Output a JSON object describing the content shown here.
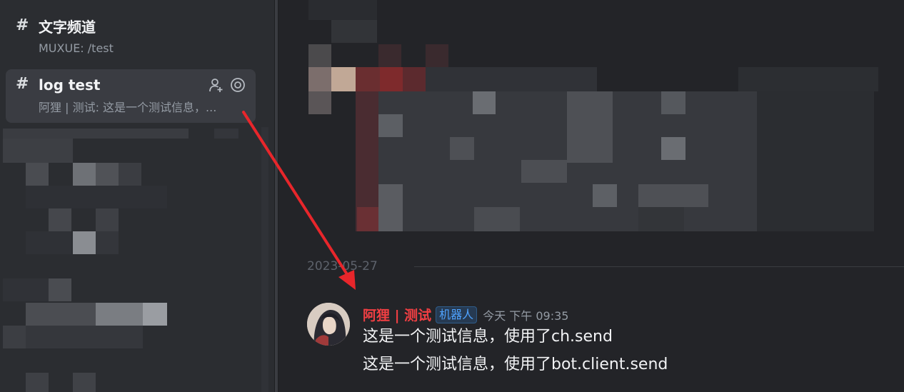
{
  "sidebar": {
    "channels": [
      {
        "title": "文字频道",
        "subtitle": "MUXUE: /test"
      },
      {
        "title": "log test",
        "subtitle": "阿狸 | 测试: 这是一个测试信息，..."
      }
    ]
  },
  "chat": {
    "date_separator": "2023-05-27",
    "message": {
      "author": "阿狸 | 测试",
      "author_color": "#f23f43",
      "badge": "机器人",
      "timestamp": "今天 下午 09:35",
      "lines": [
        "这是一个测试信息，使用了ch.send",
        "这是一个测试信息，使用了bot.client.send"
      ]
    }
  },
  "annotation": {
    "arrow_color": "#e8262b"
  }
}
